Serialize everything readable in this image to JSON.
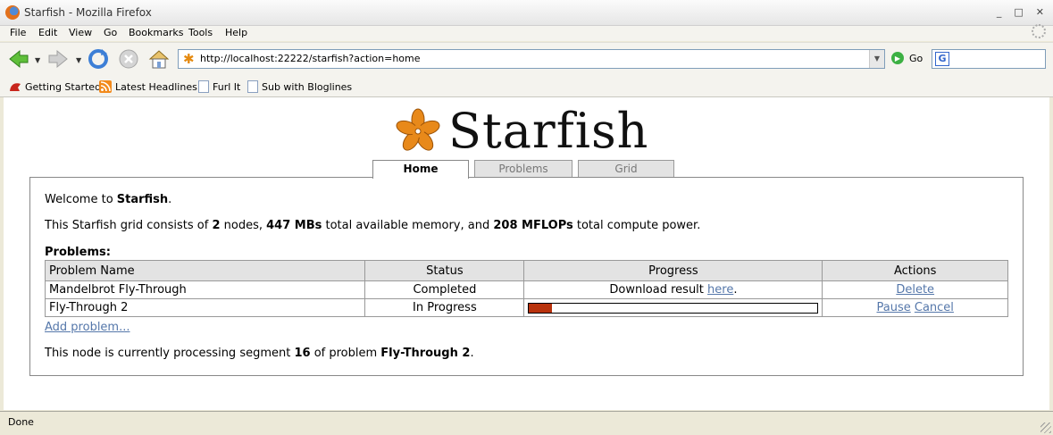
{
  "window": {
    "title": "Starfish - Mozilla Firefox",
    "controls": [
      "_",
      "□",
      "✕"
    ]
  },
  "menu": [
    "File",
    "Edit",
    "View",
    "Go",
    "Bookmarks",
    "Tools",
    "Help"
  ],
  "nav": {
    "url": "http://localhost:22222/starfish?action=home",
    "go_label": "Go"
  },
  "bookmarks": [
    "Getting Started",
    "Latest Headlines",
    "Furl It",
    "Sub with Bloglines"
  ],
  "page": {
    "logo_text": "Starfish",
    "tabs": [
      "Home",
      "Problems",
      "Grid"
    ],
    "active_tab": "Home",
    "welcome_prefix": "Welcome to ",
    "welcome_name": "Starfish",
    "welcome_suffix": ".",
    "grid_info": {
      "prefix": "This Starfish grid consists of ",
      "nodes": "2",
      "mid1": " nodes, ",
      "memory": "447 MBs",
      "mid2": " total available memory, and ",
      "compute": "208 MFLOPs",
      "suffix": " total compute power."
    },
    "problems_heading": "Problems:",
    "table": {
      "headers": [
        "Problem Name",
        "Status",
        "Progress",
        "Actions"
      ],
      "rows": [
        {
          "name": "Mandelbrot Fly-Through",
          "status": "Completed",
          "progress_text": "Download result ",
          "progress_link": "here",
          "progress_suffix": ".",
          "actions": [
            "Delete"
          ]
        },
        {
          "name": "Fly-Through 2",
          "status": "In Progress",
          "progress_fraction": 0.08,
          "actions": [
            "Pause",
            "Cancel"
          ]
        }
      ]
    },
    "add_problem": "Add problem...",
    "processing": {
      "prefix": "This node is currently processing segment ",
      "segment": "16",
      "mid": " of problem ",
      "problem": "Fly-Through 2",
      "suffix": "."
    }
  },
  "status_text": "Done",
  "colors": {
    "progress_fill": "#b8320c",
    "link": "#5577aa",
    "logo_star": "#e8891a"
  }
}
